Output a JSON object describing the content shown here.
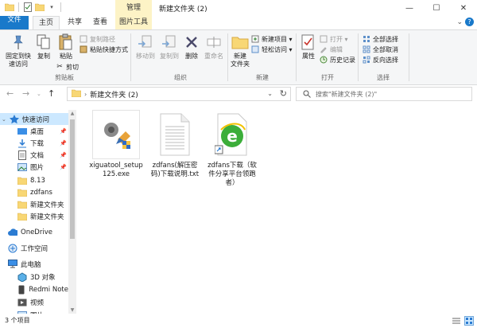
{
  "window": {
    "title": "新建文件夹 (2)",
    "manage_tab": "管理",
    "min_icon": "minimize-icon",
    "max_icon": "maximize-icon",
    "close_icon": "close-icon"
  },
  "ribbon_tabs": {
    "file": "文件",
    "home": "主页",
    "share": "共享",
    "view": "查看",
    "picture_tools": "图片工具"
  },
  "ribbon": {
    "clipboard": {
      "label": "剪贴板",
      "pin": "固定到快\n速访问",
      "copy": "复制",
      "paste": "粘贴",
      "copy_path": "复制路径",
      "paste_shortcut": "粘贴快捷方式",
      "cut": "剪切"
    },
    "organize": {
      "label": "组织",
      "move_to": "移动到",
      "copy_to": "复制到",
      "delete": "删除",
      "rename": "重命名"
    },
    "new": {
      "label": "新建",
      "new_folder": "新建\n文件夹",
      "new_item": "新建项目 ▾",
      "easy_access": "轻松访问 ▾"
    },
    "open": {
      "label": "打开",
      "properties": "属性",
      "open": "打开 ▾",
      "edit": "编辑",
      "history": "历史记录"
    },
    "select": {
      "label": "选择",
      "select_all": "全部选择",
      "select_none": "全部取消",
      "invert": "反向选择"
    }
  },
  "address": {
    "path": "新建文件夹 (2)",
    "search_placeholder": "搜索\"新建文件夹 (2)\""
  },
  "nav": {
    "quick_access": "快速访问",
    "items": [
      {
        "label": "桌面",
        "icon": "desktop-icon",
        "pinned": true
      },
      {
        "label": "下载",
        "icon": "download-icon",
        "pinned": true
      },
      {
        "label": "文档",
        "icon": "document-icon",
        "pinned": true
      },
      {
        "label": "图片",
        "icon": "picture-icon",
        "pinned": true
      },
      {
        "label": "8.13",
        "icon": "folder-icon",
        "pinned": false
      },
      {
        "label": "zdfans",
        "icon": "folder-icon",
        "pinned": false
      },
      {
        "label": "新建文件夹",
        "icon": "folder-icon",
        "pinned": false
      },
      {
        "label": "新建文件夹",
        "icon": "folder-icon",
        "pinned": false
      }
    ],
    "onedrive": "OneDrive",
    "workspace": "工作空间",
    "this_pc": "此电脑",
    "pc_items": [
      {
        "label": "3D 对象",
        "icon": "3d-objects-icon"
      },
      {
        "label": "Redmi Note",
        "icon": "phone-icon"
      },
      {
        "label": "视频",
        "icon": "video-icon"
      },
      {
        "label": "图片",
        "icon": "picture-icon"
      }
    ]
  },
  "files": [
    {
      "name": "xiguatool_setup\n125.exe",
      "icon": "installer-icon"
    },
    {
      "name": "zdfans(解压密\n码)下载说明.txt",
      "icon": "text-file-icon"
    },
    {
      "name": "zdfans下载（软\n件分享平台领跑\n者）",
      "icon": "ie-shortcut-icon"
    }
  ],
  "status": {
    "count": "3 个项目"
  },
  "colors": {
    "accent": "#1979ca",
    "selection": "#cce8ff",
    "tool_tab": "#fdf3c6",
    "folder": "#f8d775"
  }
}
